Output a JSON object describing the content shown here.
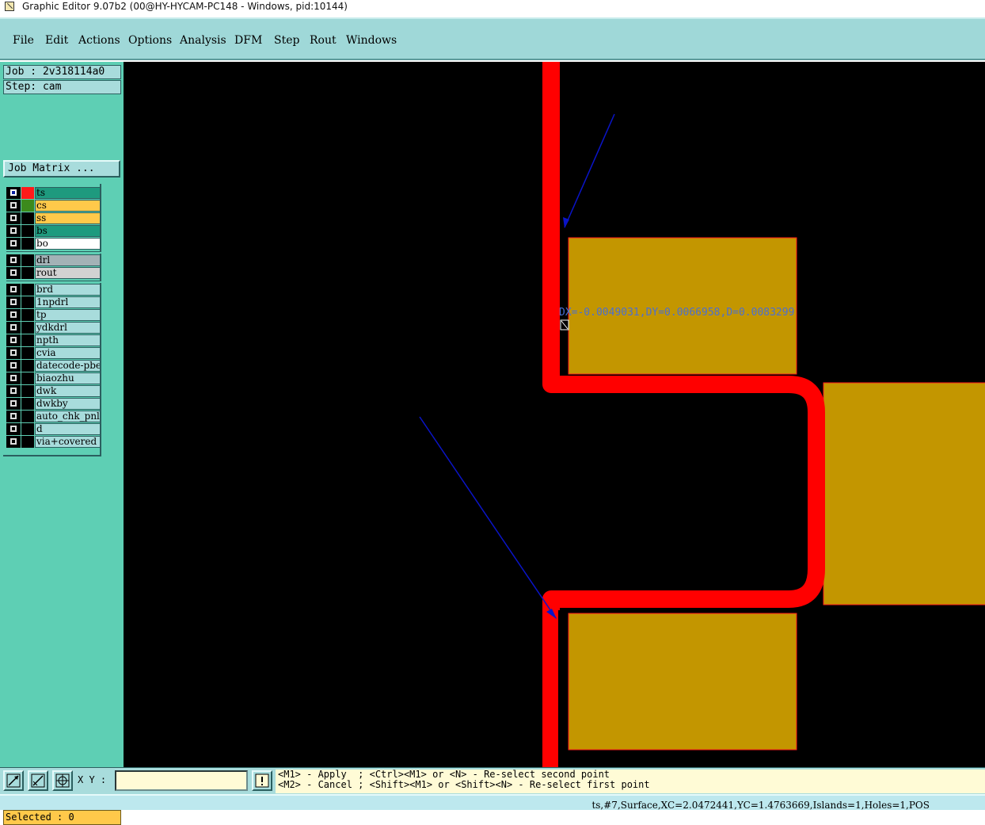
{
  "window": {
    "title": "Graphic Editor 9.07b2 (00@HY-HYCAM-PC148 - Windows, pid:10144)"
  },
  "menu": [
    "File",
    "Edit",
    "Actions",
    "Options",
    "Analysis",
    "DFM",
    "Step",
    "Rout",
    "Windows"
  ],
  "job": {
    "job_label": "Job : 2v318114a0",
    "step_label": "Step: cam",
    "matrix_button": "Job Matrix ..."
  },
  "layers": [
    {
      "name": "ts",
      "bg": "#1e9a7e",
      "color": "#ff1a1a",
      "checked": true
    },
    {
      "name": "cs",
      "bg": "#ffc94a",
      "color": "#3c8a1c",
      "checked": false
    },
    {
      "name": "ss",
      "bg": "#ffc94a",
      "color": "",
      "checked": false
    },
    {
      "name": "bs",
      "bg": "#1e9a7e",
      "color": "",
      "checked": false
    },
    {
      "name": "bo",
      "bg": "#ffffff",
      "color": "",
      "checked": false
    },
    {
      "name": "drl",
      "bg": "#a3b2b6",
      "color": "",
      "checked": false
    },
    {
      "name": "rout",
      "bg": "#d2d2d2",
      "color": "",
      "checked": false
    },
    {
      "name": "brd",
      "bg": "#a8dcdc",
      "color": "",
      "checked": false
    },
    {
      "name": "1npdrl",
      "bg": "#a8dcdc",
      "color": "",
      "checked": false
    },
    {
      "name": "tp",
      "bg": "#a8dcdc",
      "color": "",
      "checked": false
    },
    {
      "name": "ydkdrl",
      "bg": "#a8dcdc",
      "color": "",
      "checked": false
    },
    {
      "name": "npth",
      "bg": "#a8dcdc",
      "color": "",
      "checked": false
    },
    {
      "name": "cvia",
      "bg": "#a8dcdc",
      "color": "",
      "checked": false
    },
    {
      "name": "datecode-pbe",
      "bg": "#a8dcdc",
      "color": "",
      "checked": false
    },
    {
      "name": "biaozhu",
      "bg": "#a8dcdc",
      "color": "",
      "checked": false
    },
    {
      "name": "dwk",
      "bg": "#a8dcdc",
      "color": "",
      "checked": false
    },
    {
      "name": "dwkby",
      "bg": "#a8dcdc",
      "color": "",
      "checked": false
    },
    {
      "name": "auto_chk_pnl",
      "bg": "#a8dcdc",
      "color": "",
      "checked": false
    },
    {
      "name": "d",
      "bg": "#a8dcdc",
      "color": "",
      "checked": false
    },
    {
      "name": "via+covered",
      "bg": "#a8dcdc",
      "color": "",
      "checked": false
    }
  ],
  "selected_label": "Selected : 0",
  "measurement": "DX=-0.0049031,DY=0.0066958,D=0.0083299",
  "bottom": {
    "xy_label": "X Y :",
    "xy_value": "",
    "hint_line1": "<M1> - Apply  ; <Ctrl><M1> or <N> - Re-select second point",
    "hint_line2": "<M2> - Cancel ; <Shift><M1> or <Shift><N> - Re-select first point"
  },
  "status": "ts,#7,Surface,XC=2.0472441,YC=1.4763669,Islands=1,Holes=1,POS",
  "colors": {
    "trace": "#ff0000",
    "pad": "#c39600",
    "canvas": "#000000",
    "arrow": "#0a14c8",
    "panel": "#5ecfb4",
    "menubar": "#9fd8d8"
  }
}
